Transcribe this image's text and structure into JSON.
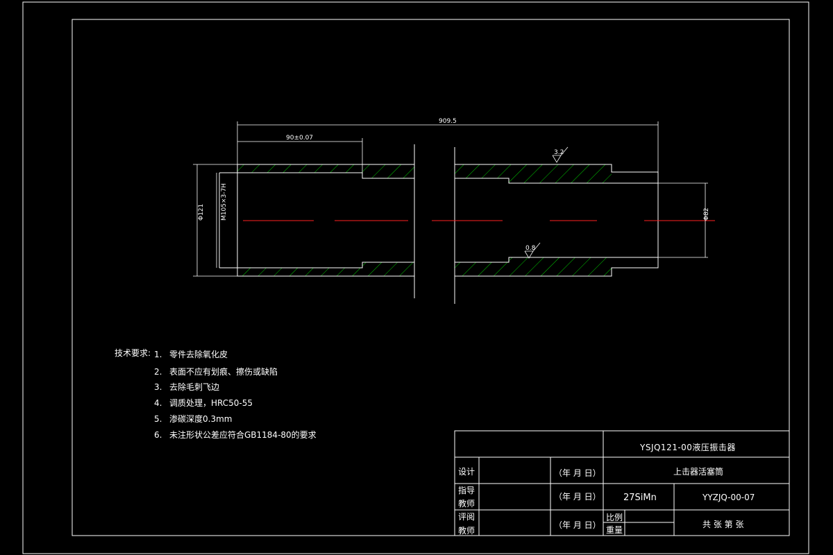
{
  "drawing": {
    "dim_overall": "909.5",
    "dim_bore_length": "90±0.07",
    "dim_outer_diameter": "Φ121",
    "dim_thread": "M105×3-7H",
    "dim_right_bore": "Φ82",
    "roughness_top": "3.2",
    "roughness_bottom": "0.8"
  },
  "notes": {
    "title": "技术要求:",
    "items": [
      {
        "num": "1.",
        "text": "零件去除氧化皮"
      },
      {
        "num": "2.",
        "text": "表面不应有划痕、擦伤或缺陷"
      },
      {
        "num": "3.",
        "text": "去除毛刺飞边"
      },
      {
        "num": "4.",
        "text": "调质处理，HRC50-55"
      },
      {
        "num": "5.",
        "text": "渗碳深度0.3mm"
      },
      {
        "num": "6.",
        "text": "未注形状公差应符合GB1184-80的要求"
      }
    ]
  },
  "title_block": {
    "project": "YSJQ121-00液压振击器",
    "part_name": "上击器活塞筒",
    "material": "27SiMn",
    "drawing_no": "YYZJQ-00-07",
    "row1_label": "设计",
    "row2_label_a": "指导",
    "row2_label_b": "教师",
    "row3_label_a": "评阅",
    "row3_label_b": "教师",
    "date_label": "（年 月 日）",
    "scale_label": "比例",
    "weight_label": "重量",
    "sheets_label": "共  张  第  张"
  }
}
